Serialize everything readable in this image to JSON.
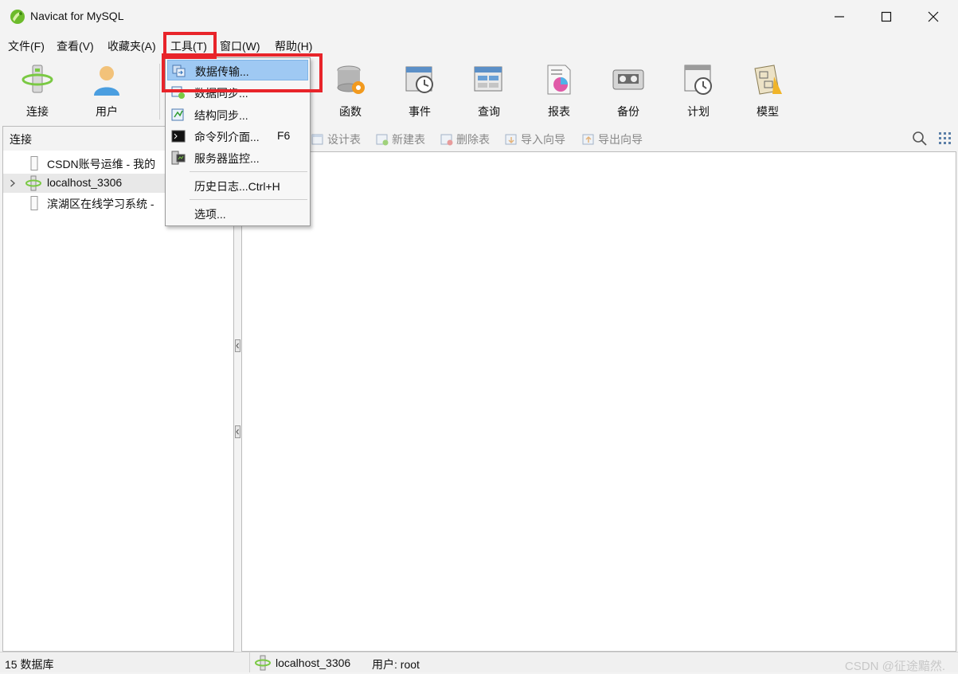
{
  "window": {
    "title": "Navicat for MySQL"
  },
  "menubar": {
    "items": [
      "文件(F)",
      "查看(V)",
      "收藏夹(A)",
      "工具(T)",
      "窗口(W)",
      "帮助(H)"
    ]
  },
  "toolbar": {
    "buttons": [
      "连接",
      "用户",
      "函数",
      "事件",
      "查询",
      "报表",
      "备份",
      "计划",
      "模型"
    ]
  },
  "connections": {
    "header": "连接",
    "items": [
      "CSDN账号运维 - 我的",
      "localhost_3306",
      "滨湖区在线学习系统 -"
    ]
  },
  "object_toolbar": {
    "buttons": [
      "设计表",
      "新建表",
      "删除表",
      "导入向导",
      "导出向导"
    ]
  },
  "tools_menu": {
    "items": [
      {
        "label": "数据传输...",
        "shortcut": ""
      },
      {
        "label": "数据同步...",
        "shortcut": ""
      },
      {
        "label": "结构同步...",
        "shortcut": ""
      },
      {
        "label": "命令列介面...",
        "shortcut": "F6"
      },
      {
        "label": "服务器监控...",
        "shortcut": ""
      },
      {
        "label": "历史日志...Ctrl+H",
        "shortcut": ""
      },
      {
        "label": "选项...",
        "shortcut": ""
      }
    ]
  },
  "statusbar": {
    "db_count": "15 数据库",
    "connection": "localhost_3306",
    "user": "用户: root",
    "watermark": "CSDN @征途黯然."
  },
  "colors": {
    "highlight_box": "#e8242a",
    "menu_active": "#9fc9f3"
  },
  "icons": [
    "navicat-logo-icon",
    "minimize-icon",
    "maximize-icon",
    "close-icon",
    "search-icon",
    "grid-icon"
  ]
}
